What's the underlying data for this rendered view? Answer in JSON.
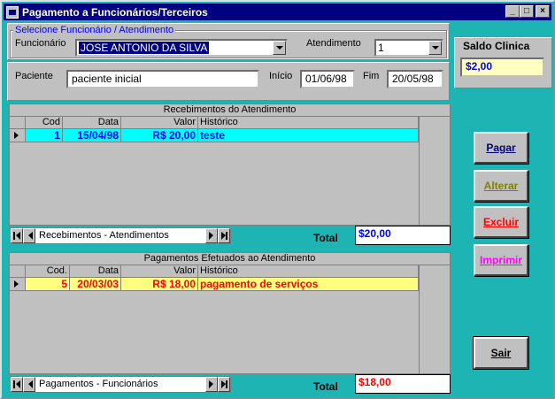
{
  "window": {
    "title": "Pagamento a Funcionários/Terceiros",
    "controls": {
      "minimize": "_",
      "maximize": "□",
      "close": "×"
    }
  },
  "selection": {
    "group_title": "Selecione Funcionário / Atendimento",
    "funcionario_label": "Funcionário",
    "funcionario_value": "JOSE ANTONIO DA SILVA",
    "atendimento_label": "Atendimento",
    "atendimento_value": "1"
  },
  "patient": {
    "paciente_label": "Paciente",
    "paciente_value": "paciente inicial",
    "inicio_label": "Início",
    "inicio_value": "01/06/98",
    "fim_label": "Fim",
    "fim_value": "20/05/98"
  },
  "saldo": {
    "label": "Saldo Clinica",
    "value": "$2,00"
  },
  "receipts": {
    "title": "Recebimentos do Atendimento",
    "columns": [
      "Cod",
      "Data",
      "Valor",
      "Histórico"
    ],
    "rows": [
      {
        "cod": "1",
        "data": "15/04/98",
        "valor": "R$ 20,00",
        "historico": "teste"
      }
    ],
    "nav_caption": "Recebimentos - Atendimentos",
    "total_label": "Total",
    "total_value": "$20,00",
    "row_bg": "#00ffff",
    "row_fg": "#0000ff"
  },
  "payments": {
    "title": "Pagamentos Efetuados ao Atendimento",
    "columns": [
      "Cod.",
      "Data",
      "Valor",
      "Histórico"
    ],
    "rows": [
      {
        "cod": "5",
        "data": "20/03/03",
        "valor": "R$ 18,00",
        "historico": "pagamento de serviços"
      }
    ],
    "nav_caption": "Pagamentos - Funcionários",
    "total_label": "Total",
    "total_value": "$18,00",
    "row_bg": "#ffff80",
    "row_fg": "#ff0000"
  },
  "buttons": {
    "pagar": {
      "label": "Pagar",
      "color": "#000080"
    },
    "alterar": {
      "label": "Alterar",
      "color": "#808000"
    },
    "excluir": {
      "label": "Excluir",
      "color": "#ff0000"
    },
    "imprimir": {
      "label": "Imprimir",
      "color": "#ff00ff"
    },
    "sair": {
      "label": "Sair",
      "color": "#000000"
    }
  },
  "icons": {
    "app": "app-icon",
    "row_pointer": "row-pointer-icon",
    "nav_first": "first-record-icon",
    "nav_prev": "prev-record-icon",
    "nav_next": "next-record-icon",
    "nav_last": "last-record-icon"
  }
}
